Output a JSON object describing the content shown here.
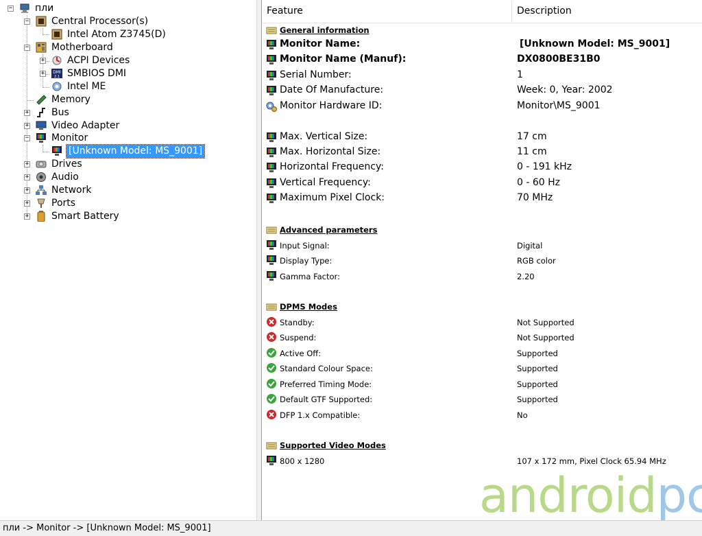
{
  "tree": {
    "root": "пли",
    "items": [
      {
        "label": "Central Processor(s)",
        "icon": "cpu-icon"
      },
      {
        "label": "Intel Atom Z3745(D)",
        "icon": "cpu-icon"
      },
      {
        "label": "Motherboard",
        "icon": "motherboard-icon"
      },
      {
        "label": "ACPI Devices",
        "icon": "acpi-icon"
      },
      {
        "label": "SMBIOS DMI",
        "icon": "dmi-icon"
      },
      {
        "label": "Intel ME",
        "icon": "gear-icon"
      },
      {
        "label": "Memory",
        "icon": "memory-icon"
      },
      {
        "label": "Bus",
        "icon": "bus-icon"
      },
      {
        "label": "Video Adapter",
        "icon": "display-icon"
      },
      {
        "label": "Monitor",
        "icon": "monitor-icon"
      },
      {
        "label": "[Unknown Model: MS_9001]",
        "icon": "monitor-icon"
      },
      {
        "label": "Drives",
        "icon": "drive-icon"
      },
      {
        "label": "Audio",
        "icon": "audio-icon"
      },
      {
        "label": "Network",
        "icon": "network-icon"
      },
      {
        "label": "Ports",
        "icon": "port-icon"
      },
      {
        "label": "Smart Battery",
        "icon": "battery-icon"
      }
    ]
  },
  "columns": {
    "feature": "Feature",
    "description": "Description"
  },
  "sections": {
    "general": "General information",
    "advanced": "Advanced parameters",
    "dpms": "DPMS Modes",
    "video": "Supported Video Modes"
  },
  "rows": {
    "monitor_name": {
      "f": "Monitor Name:",
      "v": "[Unknown Model: MS_9001]"
    },
    "monitor_name_manuf": {
      "f": "Monitor Name (Manuf):",
      "v": "DX0800BE31B0"
    },
    "serial": {
      "f": "Serial Number:",
      "v": "1"
    },
    "date": {
      "f": "Date Of Manufacture:",
      "v": "Week: 0, Year: 2002"
    },
    "hwid": {
      "f": "Monitor Hardware ID:",
      "v": "Monitor\\MS_9001"
    },
    "vsize": {
      "f": "Max. Vertical Size:",
      "v": "17 cm"
    },
    "hsize": {
      "f": "Max. Horizontal Size:",
      "v": "11 cm"
    },
    "hfreq": {
      "f": "Horizontal Frequency:",
      "v": "0 - 191 kHz"
    },
    "vfreq": {
      "f": "Vertical Frequency:",
      "v": "0 - 60 Hz"
    },
    "pixclk": {
      "f": "Maximum Pixel Clock:",
      "v": "70 MHz"
    },
    "input": {
      "f": "Input Signal:",
      "v": "Digital"
    },
    "dtype": {
      "f": "Display Type:",
      "v": "RGB color"
    },
    "gamma": {
      "f": "Gamma Factor:",
      "v": "2.20"
    },
    "standby": {
      "f": "Standby:",
      "v": "Not Supported"
    },
    "suspend": {
      "f": "Suspend:",
      "v": "Not Supported"
    },
    "activeoff": {
      "f": "Active Off:",
      "v": "Supported"
    },
    "stdcolour": {
      "f": "Standard Colour Space:",
      "v": "Supported"
    },
    "preftiming": {
      "f": "Preferred Timing Mode:",
      "v": "Supported"
    },
    "gtf": {
      "f": "Default GTF Supported:",
      "v": "Supported"
    },
    "dfp": {
      "f": "DFP 1.x Compatible:",
      "v": "No"
    },
    "mode1": {
      "f": "800 x 1280",
      "v": "107 x 172 mm, Pixel Clock 65.94 MHz"
    }
  },
  "statusbar": "пли -> Monitor ->  [Unknown Model: MS_9001]",
  "watermark": {
    "main": "android",
    "accent": "pc"
  },
  "colors": {
    "selection": "#3399ff",
    "ok": "#3aa63a",
    "error": "#cc2a2a",
    "watermark_green": "#b9d98a",
    "watermark_blue": "#9fc7e8"
  }
}
